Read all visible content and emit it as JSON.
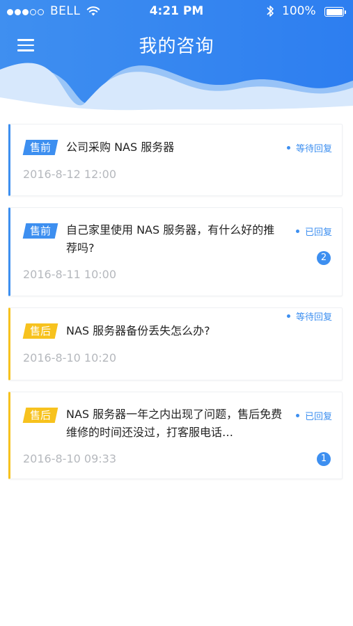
{
  "status_bar": {
    "carrier": "BELL",
    "time": "4:21 PM",
    "battery": "100%",
    "battery_level": 1.0,
    "signal_bars_filled": 3,
    "signal_bars_total": 5,
    "icons": [
      "signal-dots-icon",
      "wifi-icon",
      "bluetooth-icon",
      "battery-icon"
    ]
  },
  "header": {
    "title": "我的咨询",
    "menu_icon": "hamburger-menu-icon",
    "colors": {
      "primary": "#2d7ef0",
      "wave_light": "#cfe2fb"
    }
  },
  "consultations": [
    {
      "tag": "售前",
      "tag_color": "#3d8ff0",
      "title": "公司采购 NAS 服务器",
      "date": "2016-8-12 12:00",
      "status": "等待回复",
      "badge": ""
    },
    {
      "tag": "售前",
      "tag_color": "#3d8ff0",
      "title": "自己家里使用 NAS 服务器，有什么好的推荐吗?",
      "date": "2016-8-11 10:00",
      "status": "已回复",
      "badge": "2"
    },
    {
      "tag": "售后",
      "tag_color": "#f7c21e",
      "title": "NAS 服务器备份丢失怎么办?",
      "date": "2016-8-10 10:20",
      "status": "等待回复",
      "badge": ""
    },
    {
      "tag": "售后",
      "tag_color": "#f7c21e",
      "title": "NAS 服务器一年之内出现了问题，售后免费维修的时间还没过，打客服电话…",
      "date": "2016-8-10 09:33",
      "status": "已回复",
      "badge": "1"
    }
  ]
}
